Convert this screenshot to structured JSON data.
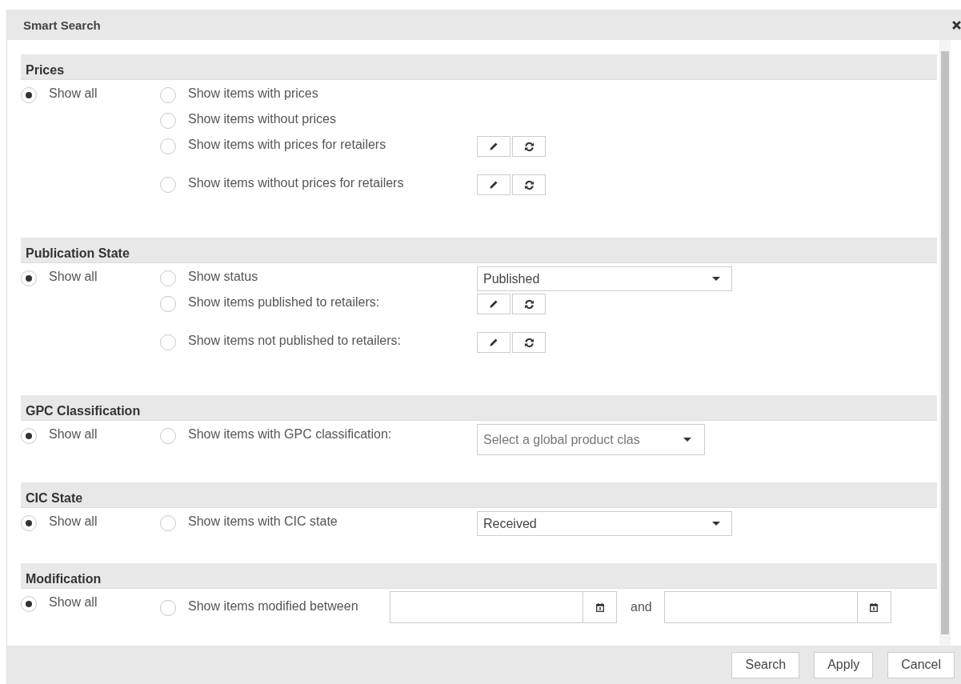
{
  "dialog": {
    "title": "Smart Search"
  },
  "sections": [
    {
      "title": "Prices",
      "show_all": {
        "label": "Show all",
        "selected": true
      },
      "options": [
        {
          "kind": "plain",
          "label": "Show items with prices",
          "selected": false
        },
        {
          "kind": "plain",
          "label": "Show items without prices",
          "selected": false
        },
        {
          "kind": "edit_refresh",
          "label": "Show items with prices for retailers",
          "selected": false
        },
        {
          "kind": "edit_refresh",
          "label": "Show items without prices for retailers",
          "selected": false
        }
      ]
    },
    {
      "title": "Publication State",
      "show_all": {
        "label": "Show all",
        "selected": true
      },
      "options": [
        {
          "kind": "select",
          "label": "Show status",
          "selected": false,
          "value": "Published"
        },
        {
          "kind": "edit_refresh",
          "label": "Show items published to retailers:",
          "selected": false
        },
        {
          "kind": "edit_refresh",
          "label": "Show items not published to retailers:",
          "selected": false
        }
      ]
    },
    {
      "title": "GPC Classification",
      "show_all": {
        "label": "Show all",
        "selected": true
      },
      "options": [
        {
          "kind": "select",
          "label": "Show items with GPC classification:",
          "selected": false,
          "placeholder": "Select a global product clas"
        }
      ]
    },
    {
      "title": "CIC State",
      "show_all": {
        "label": "Show all",
        "selected": true
      },
      "options": [
        {
          "kind": "select",
          "label": "Show items with CIC state",
          "selected": false,
          "value": "Received"
        }
      ]
    },
    {
      "title": "Modification",
      "show_all": {
        "label": "Show all",
        "selected": true
      },
      "options": [
        {
          "kind": "dates",
          "label": "Show items modified between",
          "selected": false,
          "separator": "and"
        }
      ]
    }
  ],
  "buttons": [
    "Search",
    "Apply",
    "Cancel"
  ]
}
